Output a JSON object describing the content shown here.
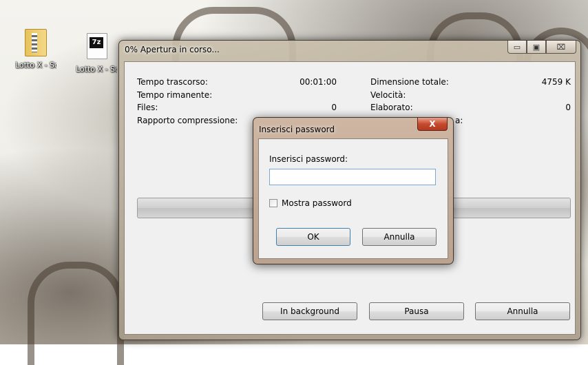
{
  "desktop": {
    "icons": [
      {
        "label": "Lotto X - Società Y",
        "kind": "folder-zip-icon"
      },
      {
        "label": "Lotto X - Società Y",
        "kind": "7z-archive-icon",
        "logo": "7z"
      }
    ]
  },
  "progress_window": {
    "title": "0% Apertura in corso...",
    "stats_left": [
      {
        "label": "Tempo trascorso:",
        "value": "00:01:00"
      },
      {
        "label": "Tempo rimanente:",
        "value": ""
      },
      {
        "label": "Files:",
        "value": "0"
      },
      {
        "label": "Rapporto compressione:",
        "value": ""
      }
    ],
    "stats_right": [
      {
        "label": "Dimensione totale:",
        "value": "4759 K"
      },
      {
        "label": "Velocità:",
        "value": ""
      },
      {
        "label": "Elaborato:",
        "value": "0"
      },
      {
        "label": "a:",
        "value": ""
      }
    ],
    "progress_fraction": 0,
    "buttons": {
      "background": "In background",
      "pause": "Pausa",
      "cancel": "Annulla"
    },
    "caption": {
      "minimize": "▭",
      "maximize": "▣",
      "close": "⌧"
    }
  },
  "password_dialog": {
    "title": "Inserisci password",
    "close_glyph": "X",
    "prompt": "Inserisci password:",
    "input_value": "",
    "show_password_label": "Mostra password",
    "show_password_checked": false,
    "ok_label": "OK",
    "cancel_label": "Annulla"
  },
  "colors": {
    "input_border": "#7aa7d6",
    "close_button": "#c64a2e"
  }
}
